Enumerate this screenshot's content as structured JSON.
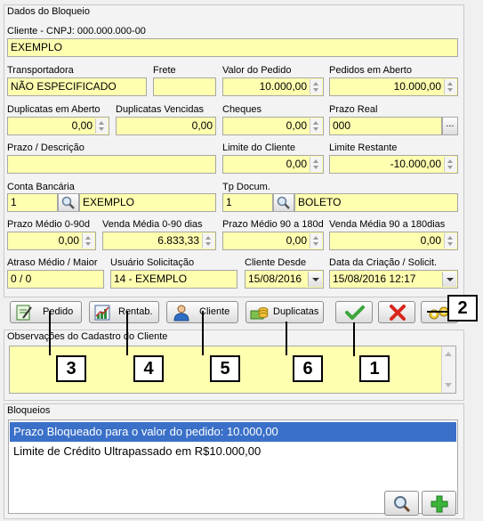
{
  "bloqueio": {
    "title": "Dados do Bloqueio",
    "cliente": {
      "label": "Cliente - CNPJ: 000.000.000-00",
      "value": "EXEMPLO"
    },
    "transportadora": {
      "label": "Transportadora",
      "value": "NÃO ESPECIFICADO"
    },
    "frete": {
      "label": "Frete",
      "value": ""
    },
    "valor_pedido": {
      "label": "Valor do Pedido",
      "value": "10.000,00"
    },
    "pedidos_aberto": {
      "label": "Pedidos em Aberto",
      "value": "10.000,00"
    },
    "duplicatas_aberto": {
      "label": "Duplicatas em Aberto",
      "value": "0,00"
    },
    "duplicatas_vencidas": {
      "label": "Duplicatas Vencidas",
      "value": "0,00"
    },
    "cheques": {
      "label": "Cheques",
      "value": "0,00"
    },
    "prazo_real": {
      "label": "Prazo Real",
      "value": "000",
      "button": "..."
    },
    "prazo_descricao": {
      "label": "Prazo / Descrição",
      "value": ""
    },
    "limite_cliente": {
      "label": "Limite do Cliente",
      "value": "0,00"
    },
    "limite_restante": {
      "label": "Limite Restante",
      "value": "-10.000,00"
    },
    "conta_bancaria": {
      "label": "Conta Bancária",
      "code": "1",
      "value": "EXEMPLO"
    },
    "tp_docum": {
      "label": "Tp Docum.",
      "code": "1",
      "value": "BOLETO"
    },
    "prazo_medio_0_90": {
      "label": "Prazo Médio 0-90d",
      "value": "0,00"
    },
    "venda_media_0_90": {
      "label": "Venda Média 0-90 dias",
      "value": "6.833,33"
    },
    "prazo_medio_90_180": {
      "label": "Prazo Médio 90 a 180d",
      "value": "0,00"
    },
    "venda_media_90_180": {
      "label": "Venda Média 90 a 180dias",
      "value": "0,00"
    },
    "atraso_medio": {
      "label": "Atraso Médio / Maior",
      "value": "0 / 0"
    },
    "usuario_solicitacao": {
      "label": "Usuário Solicitação",
      "value": "14 - EXEMPLO"
    },
    "cliente_desde": {
      "label": "Cliente Desde",
      "value": "15/08/2016"
    },
    "data_criacao": {
      "label": "Data da Criação / Solicit.",
      "value": "15/08/2016 12:17"
    }
  },
  "buttons": {
    "pedido": "Pedido",
    "rentab": "Rentab.",
    "cliente": "Cliente",
    "duplicatas": "Duplicatas"
  },
  "observacoes": {
    "title": "Observações do Cadastro do Cliente",
    "value": ""
  },
  "bloqueios": {
    "title": "Bloqueios",
    "items": [
      "Prazo Bloqueado para o valor do pedido: 10.000,00",
      "Limite de Crédito Ultrapassado em R$10.000,00"
    ]
  },
  "callouts": [
    "1",
    "2",
    "3",
    "4",
    "5",
    "6"
  ],
  "colors": {
    "field_bg": "#ffffb0",
    "selection": "#3a70c8",
    "approve": "#3aa53a",
    "reject": "#d9261c"
  }
}
